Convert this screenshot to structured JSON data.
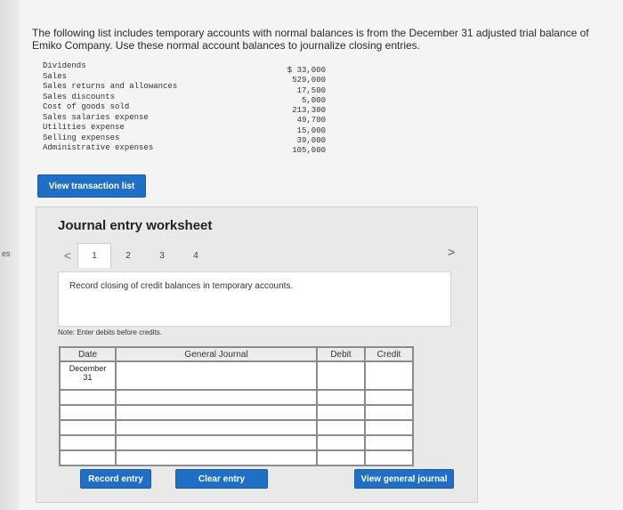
{
  "side_label": "es",
  "intro": "The following list includes temporary accounts with normal balances is from the December 31 adjusted trial balance of Emiko Company. Use these normal account balances to journalize closing entries.",
  "accounts": [
    {
      "name": "Dividends",
      "amount": "$ 33,000"
    },
    {
      "name": "Sales",
      "amount": "529,000"
    },
    {
      "name": "Sales returns and allowances",
      "amount": "17,500"
    },
    {
      "name": "Sales discounts",
      "amount": "5,000"
    },
    {
      "name": "Cost of goods sold",
      "amount": "213,300"
    },
    {
      "name": "Sales salaries expense",
      "amount": "49,700"
    },
    {
      "name": "Utilities expense",
      "amount": "15,000"
    },
    {
      "name": "Selling expenses",
      "amount": "39,000"
    },
    {
      "name": "Administrative expenses",
      "amount": "105,000"
    }
  ],
  "buttons": {
    "view_transaction_list": "View transaction list",
    "record_entry": "Record entry",
    "clear_entry": "Clear entry",
    "view_general_journal": "View general journal"
  },
  "worksheet": {
    "title": "Journal entry worksheet",
    "prev_arrow": "<",
    "next_arrow": ">",
    "pages": [
      "1",
      "2",
      "3",
      "4"
    ],
    "active_page": "1",
    "instruction": "Record closing of credit balances in temporary accounts.",
    "note": "Note: Enter debits before credits."
  },
  "journal": {
    "headers": {
      "date": "Date",
      "general_journal": "General Journal",
      "debit": "Debit",
      "credit": "Credit"
    },
    "first_date": "December\n31",
    "row_count": 6
  },
  "colors": {
    "button_blue": "#1f6fc4",
    "panel_bg": "#e9e9e9"
  }
}
